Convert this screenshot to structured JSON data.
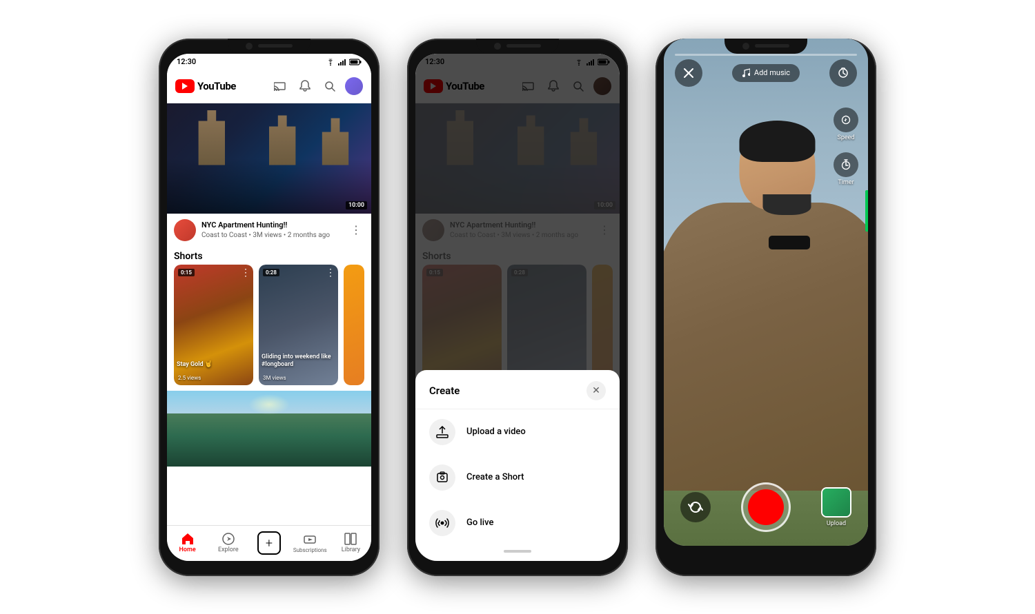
{
  "phones": [
    {
      "id": "phone1",
      "statusBar": {
        "time": "12:30",
        "signal": true,
        "wifi": true,
        "battery": true
      },
      "header": {
        "logoText": "YouTube",
        "icons": [
          "cast",
          "bell",
          "search",
          "account"
        ]
      },
      "video": {
        "duration": "10:00",
        "title": "NYC Apartment Hunting!!",
        "channel": "Coast to Coast",
        "meta": "3M views • 2 months ago"
      },
      "shortsSection": {
        "title": "Shorts",
        "items": [
          {
            "duration": "0:15",
            "title": "Stay Gold 🤘",
            "views": "2.5 views"
          },
          {
            "duration": "0:28",
            "title": "Gliding into weekend like #longboard",
            "views": "3M views"
          }
        ]
      },
      "bottomNav": [
        {
          "label": "Home",
          "active": true
        },
        {
          "label": "Explore",
          "active": false
        },
        {
          "label": "",
          "isCreate": true
        },
        {
          "label": "Subscriptions",
          "active": false
        },
        {
          "label": "Library",
          "active": false
        }
      ]
    },
    {
      "id": "phone2",
      "createModal": {
        "title": "Create",
        "items": [
          {
            "icon": "upload",
            "label": "Upload a video"
          },
          {
            "icon": "camera",
            "label": "Create a Short"
          },
          {
            "icon": "live",
            "label": "Go live"
          }
        ]
      }
    },
    {
      "id": "phone3",
      "cameraScreen": {
        "addMusicLabel": "Add music",
        "speedLabel": "Speed",
        "timerLabel": "Timer",
        "uploadLabel": "Upload",
        "progressBar": true
      }
    }
  ],
  "createShort": {
    "label": "Create Short"
  }
}
